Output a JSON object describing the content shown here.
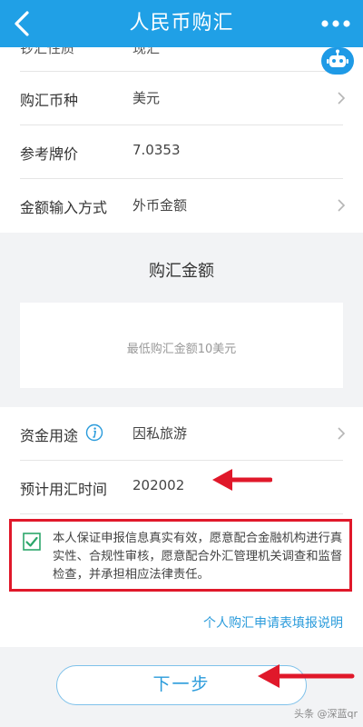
{
  "header": {
    "title": "人民币购汇"
  },
  "peek_row": {
    "label": "钞汇性质",
    "value": "现汇"
  },
  "form": {
    "currency": {
      "label": "购汇币种",
      "value": "美元"
    },
    "rate": {
      "label": "参考牌价",
      "value": "7.0353"
    },
    "input_method": {
      "label": "金额输入方式",
      "value": "外币金额"
    }
  },
  "amount": {
    "title": "购汇金额",
    "placeholder": "最低购汇金额10美元"
  },
  "purpose": {
    "label": "资金用途",
    "value": "因私旅游"
  },
  "planned_time": {
    "label": "预计用汇时间",
    "value": "202002"
  },
  "agreement": {
    "checked": true,
    "text": "本人保证申报信息真实有效，愿意配合金融机构进行真实性、合规性审核，愿意配合外汇管理机关调查和监督检查，并承担相应法律责任。"
  },
  "guide_link": "个人购汇申请表填报说明",
  "next_button": "下一步",
  "watermark": "头条 @深蓝qr",
  "colors": {
    "header": "#20a0e6",
    "accent": "#2a9bdb",
    "annotation_red": "#e0182a",
    "gray_bg": "#f2f3f5"
  }
}
